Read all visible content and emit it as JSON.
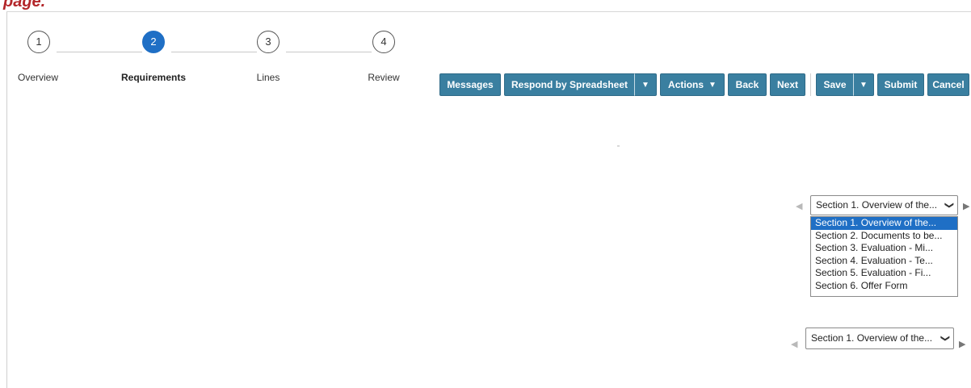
{
  "caption": "page.",
  "train": {
    "steps": [
      {
        "number": "1",
        "label": "Overview"
      },
      {
        "number": "2",
        "label": "Requirements"
      },
      {
        "number": "3",
        "label": "Lines"
      },
      {
        "number": "4",
        "label": "Review"
      }
    ],
    "current_step": 2
  },
  "toolbar": {
    "messages": "Messages",
    "respond_by_spreadsheet": "Respond by Spreadsheet",
    "actions": "Actions",
    "back": "Back",
    "next": "Next",
    "save": "Save",
    "submit": "Submit",
    "cancel": "Cancel"
  },
  "section_selector_top": {
    "selected": "Section 1. Overview of the...",
    "options": [
      "Section 1. Overview of the...",
      "Section 2. Documents to be...",
      "Section 3. Evaluation - Mi...",
      "Section 4. Evaluation - Te...",
      "Section 5. Evaluation - Fi...",
      "Section 6. Offer Form"
    ]
  },
  "section_selector_bottom": {
    "selected": "Section 1. Overview of the..."
  },
  "colors": {
    "button_bg": "#3a7fa0",
    "active_step": "#1f6fc5",
    "caption": "#b3262a"
  }
}
